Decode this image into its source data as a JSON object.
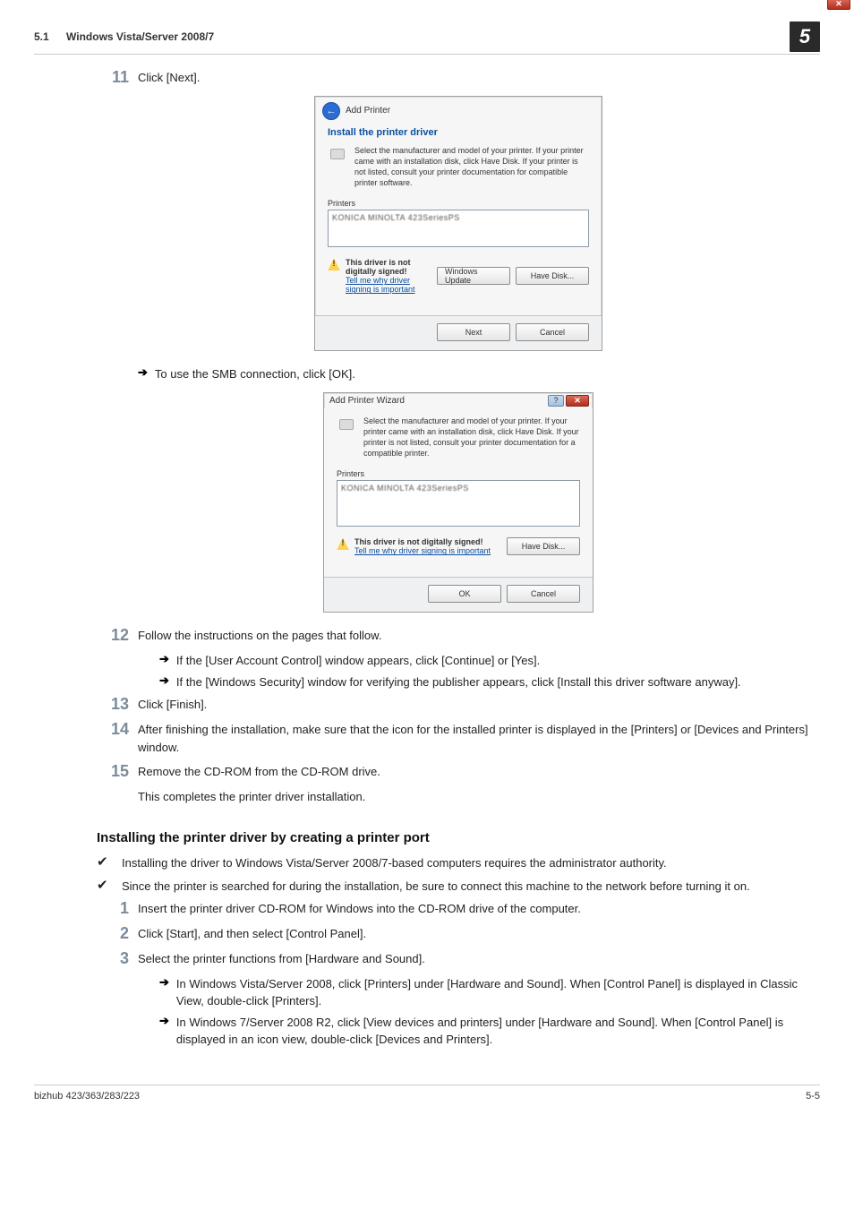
{
  "header": {
    "section": "5.1",
    "title": "Windows Vista/Server 2008/7",
    "chapter": "5"
  },
  "step11": {
    "num": "11",
    "text": "Click [Next]."
  },
  "dialog1": {
    "title": "Add Printer",
    "heading": "Install the printer driver",
    "msg": "Select the manufacturer and model of your printer. If your printer came with an installation disk, click Have Disk. If your printer is not listed, consult your printer documentation for compatible printer software.",
    "printers_label": "Printers",
    "list_item": "KONICA MINOLTA 423SeriesPS",
    "warn_bold": "This driver is not digitally signed!",
    "warn_link": "Tell me why driver signing is important",
    "btn_winupdate": "Windows Update",
    "btn_havedisk": "Have Disk...",
    "btn_next": "Next",
    "btn_cancel": "Cancel"
  },
  "noteUseSmb": "To use the SMB connection, click [OK].",
  "dialog2": {
    "title": "Add Printer Wizard",
    "msg": "Select the manufacturer and model of your printer. If your printer came with an installation disk, click Have Disk. If your printer is not listed, consult your printer documentation for a compatible printer.",
    "printers_label": "Printers",
    "list_item": "KONICA MINOLTA 423SeriesPS",
    "warn_bold": "This driver is not digitally signed!",
    "warn_link": "Tell me why driver signing is important",
    "btn_havedisk": "Have Disk...",
    "btn_ok": "OK",
    "btn_cancel": "Cancel"
  },
  "step12": {
    "num": "12",
    "text": "Follow the instructions on the pages that follow.",
    "sub1": "If the [User Account Control] window appears, click [Continue] or [Yes].",
    "sub2": "If the [Windows Security] window for verifying the publisher appears, click [Install this driver software anyway]."
  },
  "step13": {
    "num": "13",
    "text": "Click [Finish]."
  },
  "step14": {
    "num": "14",
    "text": "After finishing the installation, make sure that the icon for the installed printer is displayed in the [Printers] or [Devices and Printers] window."
  },
  "step15": {
    "num": "15",
    "text": "Remove the CD-ROM from the CD-ROM drive.",
    "after": "This completes the printer driver installation."
  },
  "subhead": "Installing the printer driver by creating a printer port",
  "check1": "Installing the driver to Windows Vista/Server 2008/7-based computers requires the administrator authority.",
  "check2": "Since the printer is searched for during the installation, be sure to connect this machine to the network before turning it on.",
  "newstep1": {
    "num": "1",
    "text": "Insert the printer driver CD-ROM for Windows into the CD-ROM drive of the computer."
  },
  "newstep2": {
    "num": "2",
    "text": "Click [Start], and then select [Control Panel]."
  },
  "newstep3": {
    "num": "3",
    "text": "Select the printer functions from [Hardware and Sound].",
    "sub1": "In Windows Vista/Server 2008, click [Printers] under [Hardware and Sound]. When [Control Panel] is displayed in Classic View, double-click [Printers].",
    "sub2": "In Windows 7/Server 2008 R2, click [View devices and printers] under [Hardware and Sound]. When [Control Panel] is displayed in an icon view, double-click [Devices and Printers]."
  },
  "footer": {
    "left": "bizhub 423/363/283/223",
    "right": "5-5"
  }
}
